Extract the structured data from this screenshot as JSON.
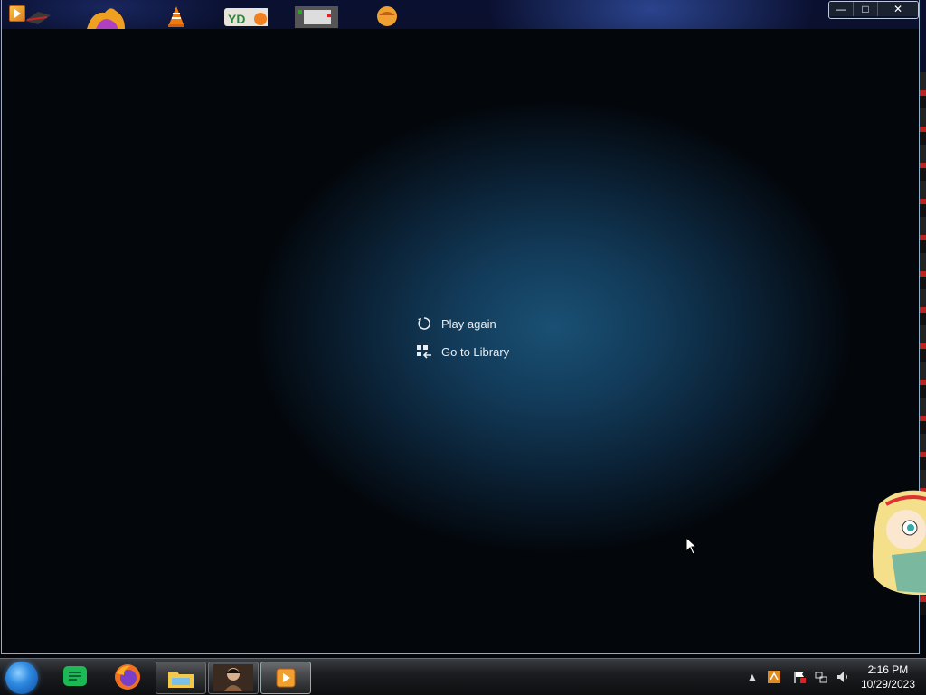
{
  "desktop_icons": [
    "hat-app-icon",
    "firefox-dev-icon",
    "vlc-icon",
    "ytd-icon",
    "terminal-icon",
    "avatar-app-icon"
  ],
  "window": {
    "minimize": "—",
    "maximize": "□",
    "close": "✕"
  },
  "player": {
    "play_again_label": "Play again",
    "go_to_library_label": "Go to Library"
  },
  "taskbar": {
    "pinned": [
      "notes-icon",
      "firefox-icon",
      "file-explorer-icon",
      "portrait-app-icon",
      "media-player-icon"
    ]
  },
  "tray": {
    "time": "2:16 PM",
    "date": "10/29/2023"
  }
}
